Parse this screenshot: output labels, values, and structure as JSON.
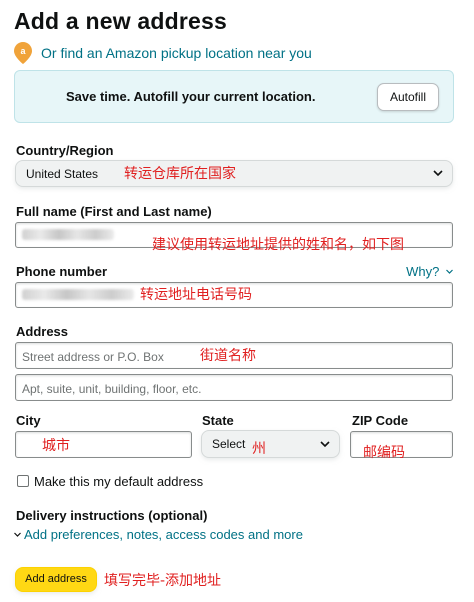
{
  "page": {
    "title": "Add a new address"
  },
  "pickup": {
    "link_text": "Or find an Amazon pickup location near you"
  },
  "banner": {
    "text": "Save time. Autofill your current location.",
    "button_label": "Autofill"
  },
  "country": {
    "label": "Country/Region",
    "value": "United States",
    "annotation": "转运仓库所在国家"
  },
  "full_name": {
    "label": "Full name (First and Last name)",
    "annotation": "建议使用转运地址提供的姓和名，如下图"
  },
  "phone": {
    "label": "Phone number",
    "why_link": "Why?",
    "annotation": "转运地址电话号码"
  },
  "address": {
    "label": "Address",
    "line1_placeholder": "Street address or P.O. Box",
    "line2_placeholder": "Apt, suite, unit, building, floor, etc.",
    "annotation": "街道名称"
  },
  "city": {
    "label": "City",
    "annotation": "城市"
  },
  "state": {
    "label": "State",
    "value": "Select",
    "annotation": "州"
  },
  "zip": {
    "label": "ZIP Code",
    "annotation": "邮编码"
  },
  "default_address": {
    "label": "Make this my default address",
    "checked": false
  },
  "delivery": {
    "heading": "Delivery instructions (optional)",
    "link_text": "Add preferences, notes, access codes and more"
  },
  "submit": {
    "label": "Add address",
    "annotation": "填写完毕-添加地址"
  },
  "colors": {
    "link": "#007185",
    "annotation_red": "#e02020",
    "button_yellow": "#ffd814",
    "banner_bg": "#e7f6f8"
  },
  "icons": {
    "pin": "location-pin-icon",
    "chevron": "chevron-down-icon"
  }
}
